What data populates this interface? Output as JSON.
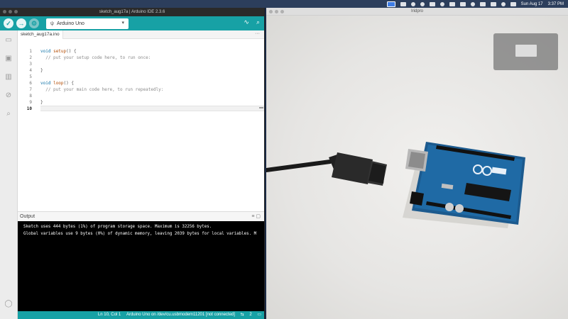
{
  "menubar": {
    "apple_glyph": "",
    "date": "Sun Aug 17",
    "time": "3:37 PM"
  },
  "ide": {
    "window_title": "sketch_aug17a | Arduino IDE 2.3.6",
    "board": "Arduino Uno",
    "tab_name": "sketch_aug17a.ino",
    "tab_more": "···",
    "line_numbers": [
      "1",
      "2",
      "3",
      "4",
      "5",
      "6",
      "7",
      "8",
      "9",
      "10"
    ],
    "code": {
      "l1_kw": "void",
      "l1_fn": "setup",
      "l1_rest": "() {",
      "l2": "  // put your setup code here, to run once:",
      "l4": "}",
      "l6_kw": "void",
      "l6_fn": "loop",
      "l6_rest": "() {",
      "l7": "  // put your main code here, to run repeatedly:",
      "l9": "}"
    },
    "output_label": "Output",
    "output_lines": [
      "Sketch uses 444 bytes (1%) of program storage space. Maximum is 32256 bytes.",
      "Global variables use 9 bytes (0%) of dynamic memory, leaving 2039 bytes for local variables. M"
    ],
    "status": {
      "position": "Ln 10, Col 1",
      "port": "Arduino Uno on /dev/cu.usbmodem11201 [not connected]",
      "notifications": "2"
    }
  },
  "cam": {
    "window_title": "Iridpro"
  },
  "colors": {
    "arduino_teal": "#17a1a5",
    "output_bg": "#000000"
  }
}
